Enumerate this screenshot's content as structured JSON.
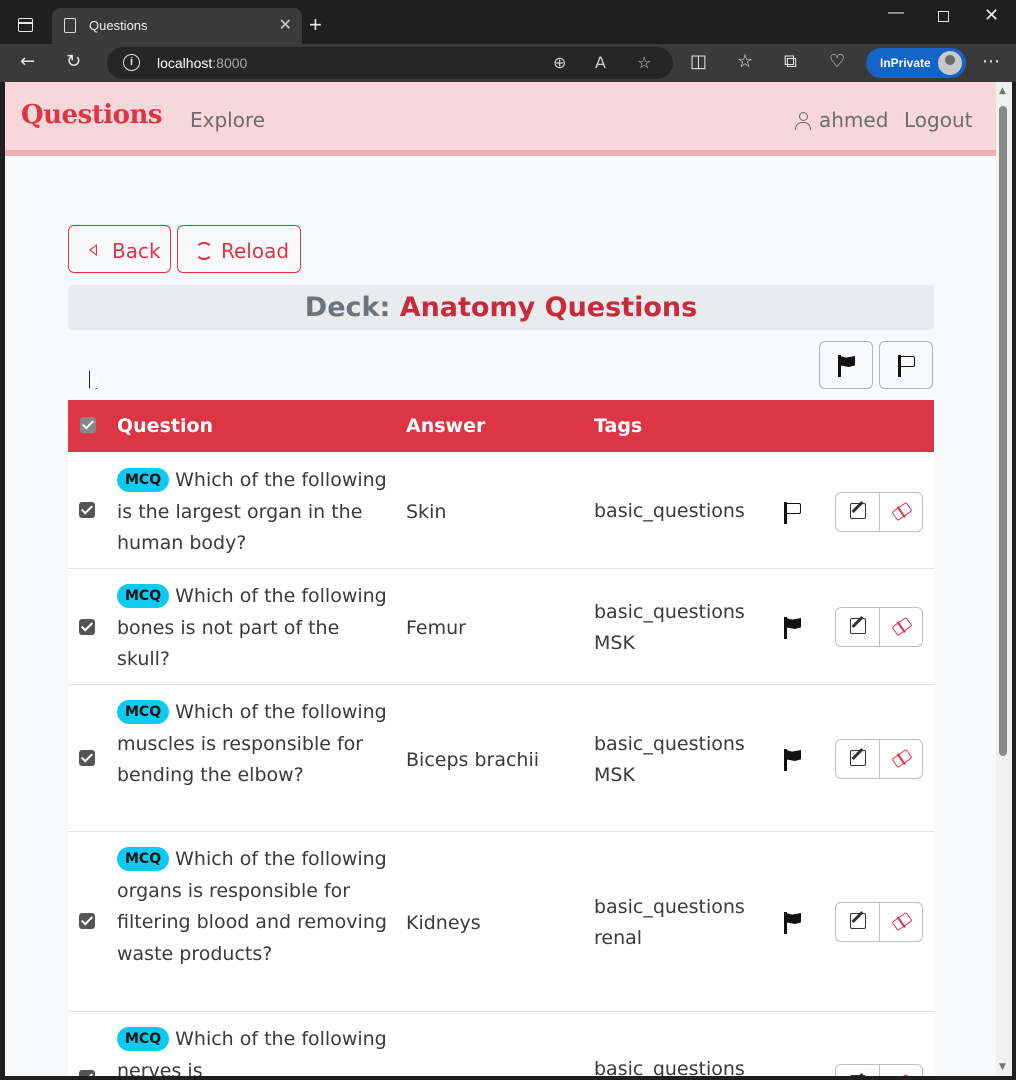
{
  "browser": {
    "tab_title": "Questions",
    "tab_close": "✕",
    "new_tab": "+",
    "address_host": "localhost",
    "address_port": ":8000",
    "inprivate_label": "InPrivate",
    "controls": {
      "minimize": "—",
      "close": "✕"
    },
    "icons": [
      "back-arrow-icon",
      "refresh-icon",
      "zoom-icon",
      "read-aloud-icon",
      "favorite-star-icon",
      "split-screen-icon",
      "favorites-icon",
      "collections-icon",
      "health-icon",
      "more-icon"
    ]
  },
  "navbar": {
    "brand": "Questions",
    "explore": "Explore",
    "username": "ahmed",
    "logout": "Logout"
  },
  "buttons": {
    "back": "Back",
    "reload": "Reload"
  },
  "deck": {
    "label": "Deck:",
    "name": "Anatomy Questions"
  },
  "table": {
    "headers": {
      "question": "Question",
      "answer": "Answer",
      "tags": "Tags"
    },
    "rows": [
      {
        "badge": "MCQ",
        "question": "Which of the following is the largest organ in the human body?",
        "answer": "Skin",
        "tags": [
          "basic_questions"
        ],
        "flagged": false,
        "checked": true
      },
      {
        "badge": "MCQ",
        "question": "Which of the following bones is not part of the skull?",
        "answer": "Femur",
        "tags": [
          "basic_questions",
          "MSK"
        ],
        "flagged": true,
        "checked": true
      },
      {
        "badge": "MCQ",
        "question": "Which of the following muscles is responsible for bending the elbow?",
        "answer": "Biceps brachii",
        "tags": [
          "basic_questions",
          "MSK"
        ],
        "flagged": true,
        "checked": true
      },
      {
        "badge": "MCQ",
        "question": "Which of the following organs is responsible for filtering blood and removing waste products?",
        "answer": "Kidneys",
        "tags": [
          "basic_questions",
          "renal"
        ],
        "flagged": true,
        "checked": true
      },
      {
        "badge": "MCQ",
        "question": "Which of the following nerves is",
        "answer": "",
        "tags": [
          "basic_questions"
        ],
        "flagged": false,
        "checked": true
      }
    ]
  },
  "colors": {
    "accent": "#dc3545",
    "navbar_bg": "#f8d7da",
    "badge": "#0dcaf0",
    "deck_bar": "#e9ecef"
  }
}
